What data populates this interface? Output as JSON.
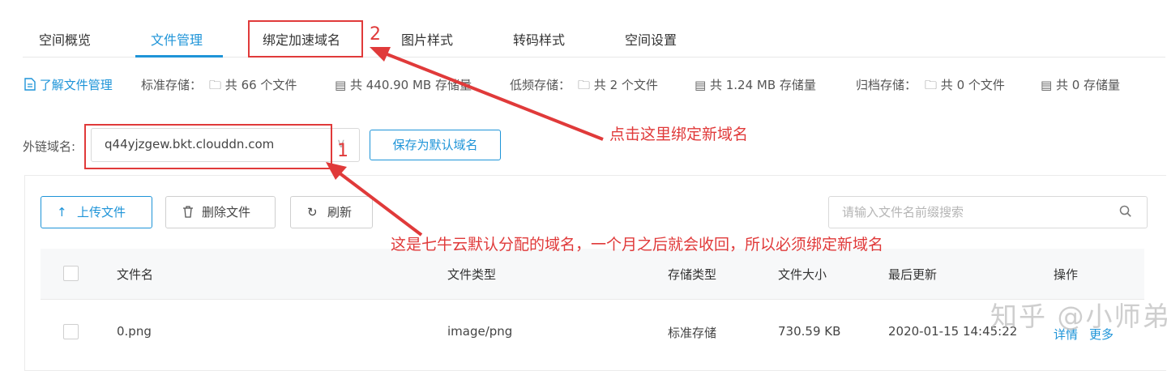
{
  "tabs": [
    {
      "label": "空间概览"
    },
    {
      "label": "文件管理",
      "active": true
    },
    {
      "label": "绑定加速域名"
    },
    {
      "label": "图片样式"
    },
    {
      "label": "转码样式"
    },
    {
      "label": "空间设置"
    }
  ],
  "stats": {
    "learn_link": "了解文件管理",
    "standard_label": "标准存储：",
    "standard_files": "共 66 个文件",
    "standard_size": "共 440.90 MB 存储量",
    "infrequent_label": "低频存储：",
    "infrequent_files": "共 2 个文件",
    "infrequent_size": "共 1.24 MB 存储量",
    "archive_label": "归档存储：",
    "archive_files": "共 0 个文件",
    "archive_size": "共 0 存储量"
  },
  "domain": {
    "label": "外链域名:",
    "value": "q44yjzgew.bkt.clouddn.com",
    "save_default_label": "保存为默认域名"
  },
  "toolbar": {
    "upload_label": "上传文件",
    "delete_label": "删除文件",
    "refresh_label": "刷新",
    "search_placeholder": "请输入文件名前缀搜索"
  },
  "table": {
    "headers": {
      "name": "文件名",
      "type": "文件类型",
      "storage": "存储类型",
      "size": "文件大小",
      "updated": "最后更新",
      "actions": "操作"
    },
    "rows": [
      {
        "name": "0.png",
        "type": "image/png",
        "storage": "标准存储",
        "size": "730.59 KB",
        "updated": "2020-01-15 14:45:22",
        "details_label": "详情",
        "more_label": "更多"
      }
    ]
  },
  "annotations": {
    "num1": "1",
    "num2": "2",
    "note_bind": "点击这里绑定新域名",
    "note_default": "这是七牛云默认分配的域名，一个月之后就会收回，所以必须绑定新域名",
    "color": "#e03a3a"
  },
  "watermark": "知乎 @小师弟",
  "colors": {
    "accent": "#1e94d8"
  }
}
